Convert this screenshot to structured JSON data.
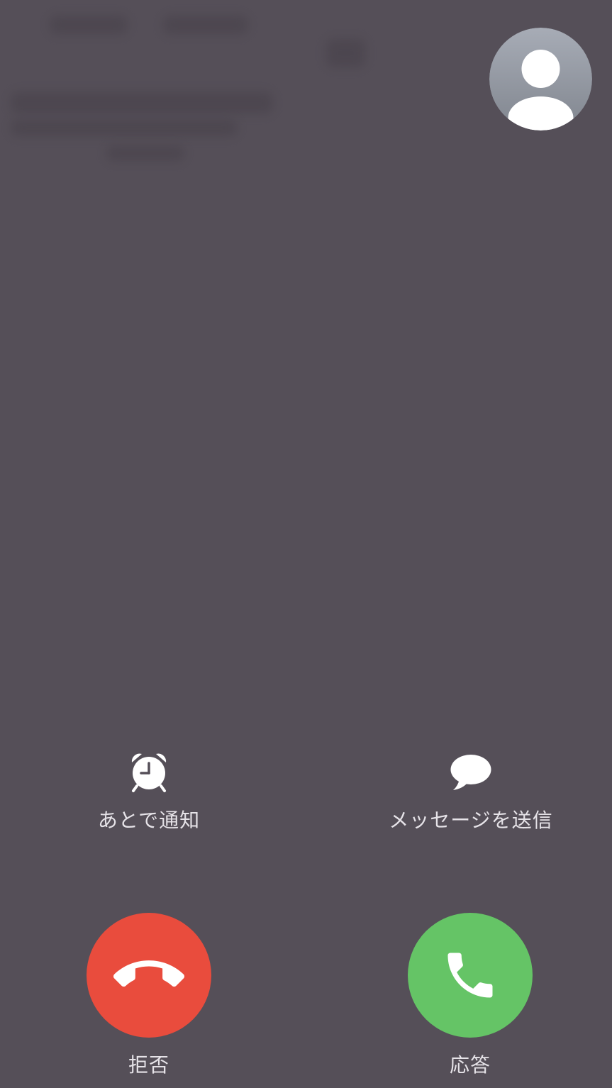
{
  "colors": {
    "background": "#554f58",
    "decline": "#e94c3d",
    "accept": "#65c466"
  },
  "avatar": {
    "icon": "person-icon"
  },
  "actions": {
    "remind": {
      "label": "あとで通知",
      "icon": "alarm-clock-icon"
    },
    "message": {
      "label": "メッセージを送信",
      "icon": "message-bubble-icon"
    }
  },
  "call": {
    "decline": {
      "label": "拒否",
      "icon": "phone-hangup-icon"
    },
    "accept": {
      "label": "応答",
      "icon": "phone-icon"
    }
  }
}
